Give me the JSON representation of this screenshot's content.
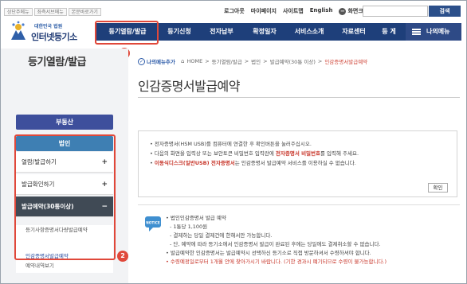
{
  "utility": {
    "quick_links": [
      "상단주메뉴",
      "좌측서브메뉴",
      "본문바로가기"
    ],
    "nav": [
      "로그아웃",
      "마이페이지",
      "사이트맵",
      "English"
    ],
    "zoom_label": "화면크기",
    "zoom_out": "−",
    "zoom_in": "+",
    "search_button": "검색"
  },
  "logo": {
    "subtitle": "대한민국 법원",
    "title": "인터넷등기소"
  },
  "main_nav": {
    "items": [
      "등기열람/발급",
      "등기신청",
      "전자납부",
      "확정일자",
      "서비스소개",
      "자료센터",
      "등 게"
    ],
    "my_menu": "나의메뉴"
  },
  "badges": {
    "one": "1",
    "two": "2"
  },
  "sidebar": {
    "title": "등기열람/발급",
    "categories": [
      "부동산",
      "법인"
    ],
    "menu": [
      {
        "label": "열람/발급하기",
        "icon": "+"
      },
      {
        "label": "발급확인하기",
        "icon": "+"
      },
      {
        "label": "발급예약(30통이상)",
        "icon": "−"
      }
    ],
    "submenu": [
      "등기사항증명서다량발급예약",
      "인감증명서발급예약",
      "예약내역보기"
    ]
  },
  "content": {
    "my_menu_tag": "나의메뉴추가",
    "breadcrumb": [
      "HOME",
      "등기열람/발급",
      "법인",
      "발급예약(30통 이상)",
      "인감증명서발급예약"
    ],
    "page_title": "인감증명서발급예약",
    "notice": [
      {
        "pre": "• 전자증명서(HSM USB)를 컴퓨터에 연결한 후 확인버튼을 눌러주십시오.",
        "red": "",
        "post": ""
      },
      {
        "pre": "• 다음의 화면을 입력상 또는 보안토큰 비밀번호 입력란에 ",
        "red": "전자증명서 비밀번호",
        "post": "를 입력해 주세요."
      },
      {
        "pre": "• ",
        "red": "이동식디스크(일반USB) 전자증명서",
        "post": "는 인감증명서 발급예약 서비스를 이용하실 수 없습니다."
      }
    ],
    "confirm_button": "확인",
    "notice_icon_label": "NOTICE",
    "info": [
      {
        "text": "• 법인인감증명서 발급 예약",
        "red": false
      },
      {
        "text": "- 1통당 1,100원",
        "red": false
      },
      {
        "text": "- 결제하는 당일 결제건에 한해서만 가능합니다.",
        "red": false
      },
      {
        "text": "- 단, 예약에 따라 등기소에서 인감증명서 발급이 완료된 후에는 당일에도 결제취소할 수 없습니다.",
        "red": false
      },
      {
        "text": "• 발급예약한 인감증명서는 발급예약시 선택하신 등기소로 직접 방문하셔서 수령하셔야 합니다.",
        "red": false
      },
      {
        "text": "• 수령예정일로부터 1개월 안에 찾아가시기 바랍니다. (기한 경과시 폐기되므로 수령이 불가능합니다.)",
        "red": true
      }
    ]
  },
  "colors": {
    "nav_bg": "#1e3f7a",
    "highlight": "#e0483a",
    "category_inactive": "#3e4f9c",
    "category_active": "#3e7fb3",
    "menu_dark": "#404a55",
    "alert_red": "#c8372b"
  }
}
